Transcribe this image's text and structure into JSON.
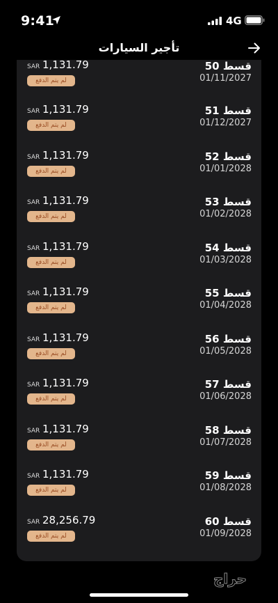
{
  "status_bar": {
    "time": "9:41",
    "network": "4G"
  },
  "header": {
    "title": "تأجير السيارات"
  },
  "installments": [
    {
      "label": "قسط 50",
      "date": "01/11/2027",
      "currency": "SAR",
      "amount": "1,131.79",
      "status": "لم يتم الدفع"
    },
    {
      "label": "قسط 51",
      "date": "01/12/2027",
      "currency": "SAR",
      "amount": "1,131.79",
      "status": "لم يتم الدفع"
    },
    {
      "label": "قسط 52",
      "date": "01/01/2028",
      "currency": "SAR",
      "amount": "1,131.79",
      "status": "لم يتم الدفع"
    },
    {
      "label": "قسط 53",
      "date": "01/02/2028",
      "currency": "SAR",
      "amount": "1,131.79",
      "status": "لم يتم الدفع"
    },
    {
      "label": "قسط 54",
      "date": "01/03/2028",
      "currency": "SAR",
      "amount": "1,131.79",
      "status": "لم يتم الدفع"
    },
    {
      "label": "قسط 55",
      "date": "01/04/2028",
      "currency": "SAR",
      "amount": "1,131.79",
      "status": "لم يتم الدفع"
    },
    {
      "label": "قسط 56",
      "date": "01/05/2028",
      "currency": "SAR",
      "amount": "1,131.79",
      "status": "لم يتم الدفع"
    },
    {
      "label": "قسط 57",
      "date": "01/06/2028",
      "currency": "SAR",
      "amount": "1,131.79",
      "status": "لم يتم الدفع"
    },
    {
      "label": "قسط 58",
      "date": "01/07/2028",
      "currency": "SAR",
      "amount": "1,131.79",
      "status": "لم يتم الدفع"
    },
    {
      "label": "قسط 59",
      "date": "01/08/2028",
      "currency": "SAR",
      "amount": "1,131.79",
      "status": "لم يتم الدفع"
    },
    {
      "label": "قسط 60",
      "date": "01/09/2028",
      "currency": "SAR",
      "amount": "28,256.79",
      "status": "لم يتم الدفع"
    }
  ],
  "watermark": {
    "logo_text": "حراج"
  },
  "colors": {
    "background": "#000000",
    "card": "#1c1c1e",
    "badge_bg": "#e3b68c",
    "badge_text": "#9a4d24"
  }
}
